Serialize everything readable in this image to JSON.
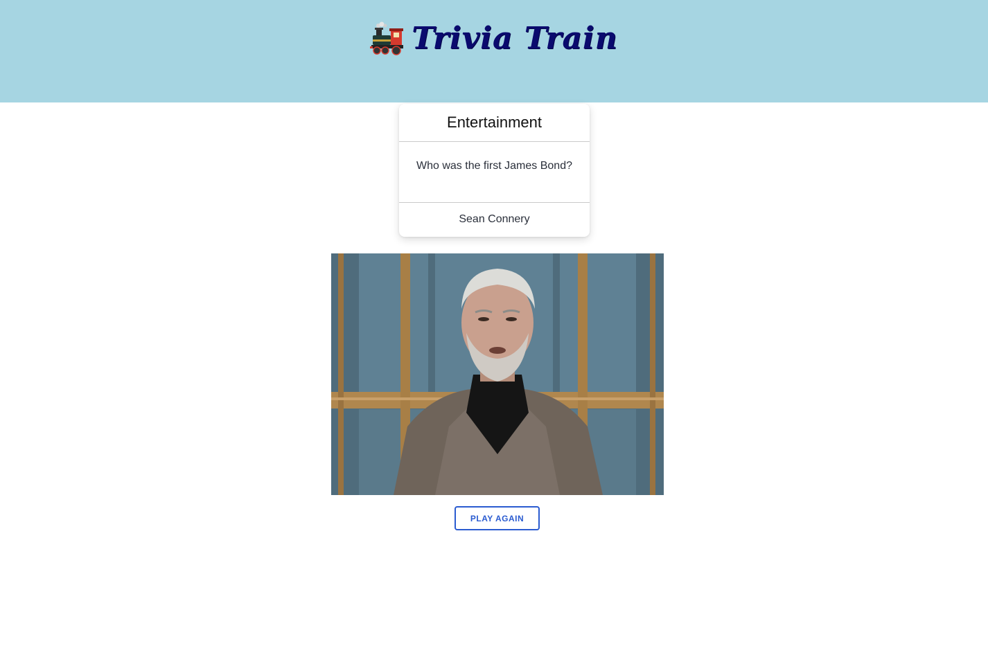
{
  "header": {
    "title": "Trivia Train",
    "icon": "train-icon",
    "background_color": "#a6d5e2",
    "title_color": "#0a0a6e"
  },
  "card": {
    "category": "Entertainment",
    "question": "Who was the first James Bond?",
    "answer": "Sean Connery"
  },
  "result_image": {
    "subject": "man-in-tweed-jacket-photo"
  },
  "actions": {
    "play_again_label": "PLAY AGAIN",
    "accent_color": "#2a5bd0"
  }
}
